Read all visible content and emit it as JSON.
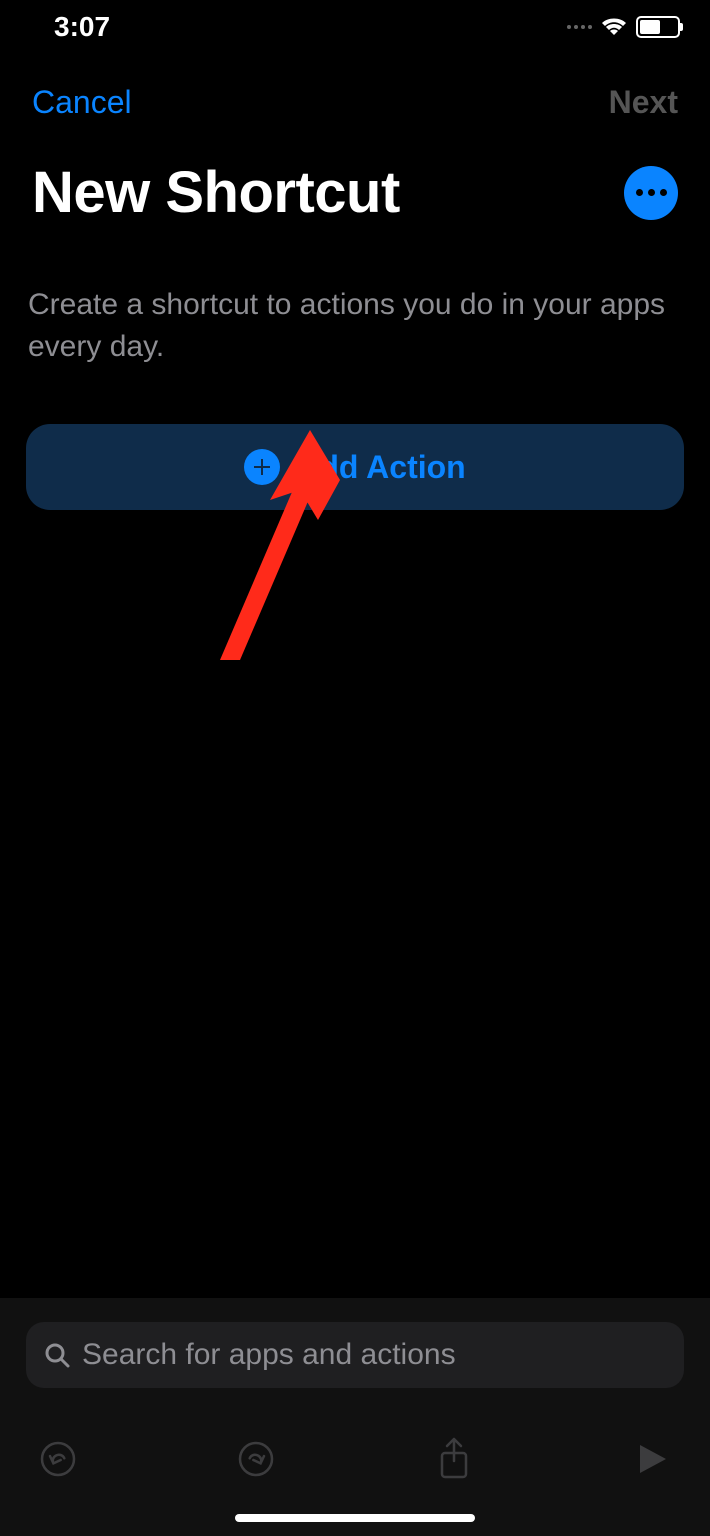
{
  "status": {
    "time": "3:07"
  },
  "nav": {
    "cancel": "Cancel",
    "next": "Next"
  },
  "header": {
    "title": "New Shortcut"
  },
  "description": "Create a shortcut to actions you do in your apps every day.",
  "addAction": {
    "label": "Add Action"
  },
  "search": {
    "placeholder": "Search for apps and actions"
  }
}
